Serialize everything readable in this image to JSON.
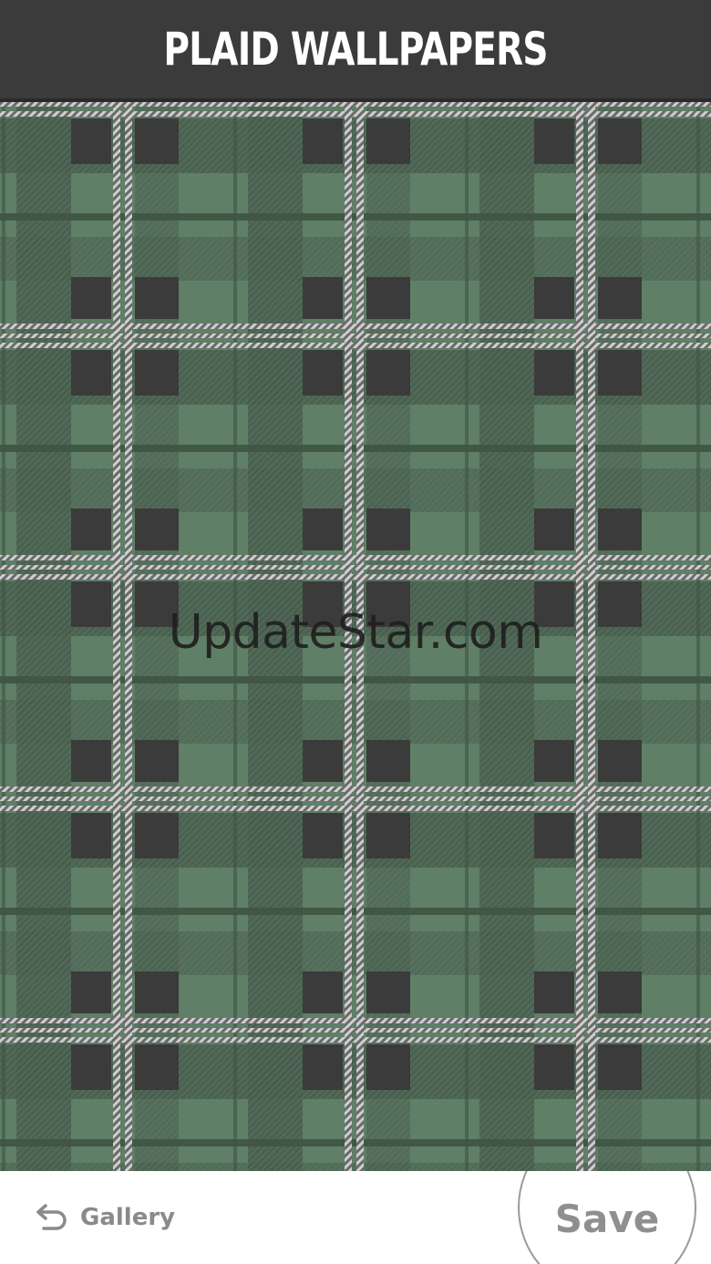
{
  "header": {
    "title": "PLAID WALLPAPERS"
  },
  "wallpaper": {
    "watermark": "UpdateStar.com",
    "colors": {
      "base_green": "#5f7f66",
      "dark_green": "#4a6150",
      "dark_band": "#3a3a3a",
      "stripe_light": "#c8c8c8"
    }
  },
  "bottom_bar": {
    "gallery_label": "Gallery",
    "gallery_icon": "back-arrow-icon",
    "save_label": "Save"
  }
}
